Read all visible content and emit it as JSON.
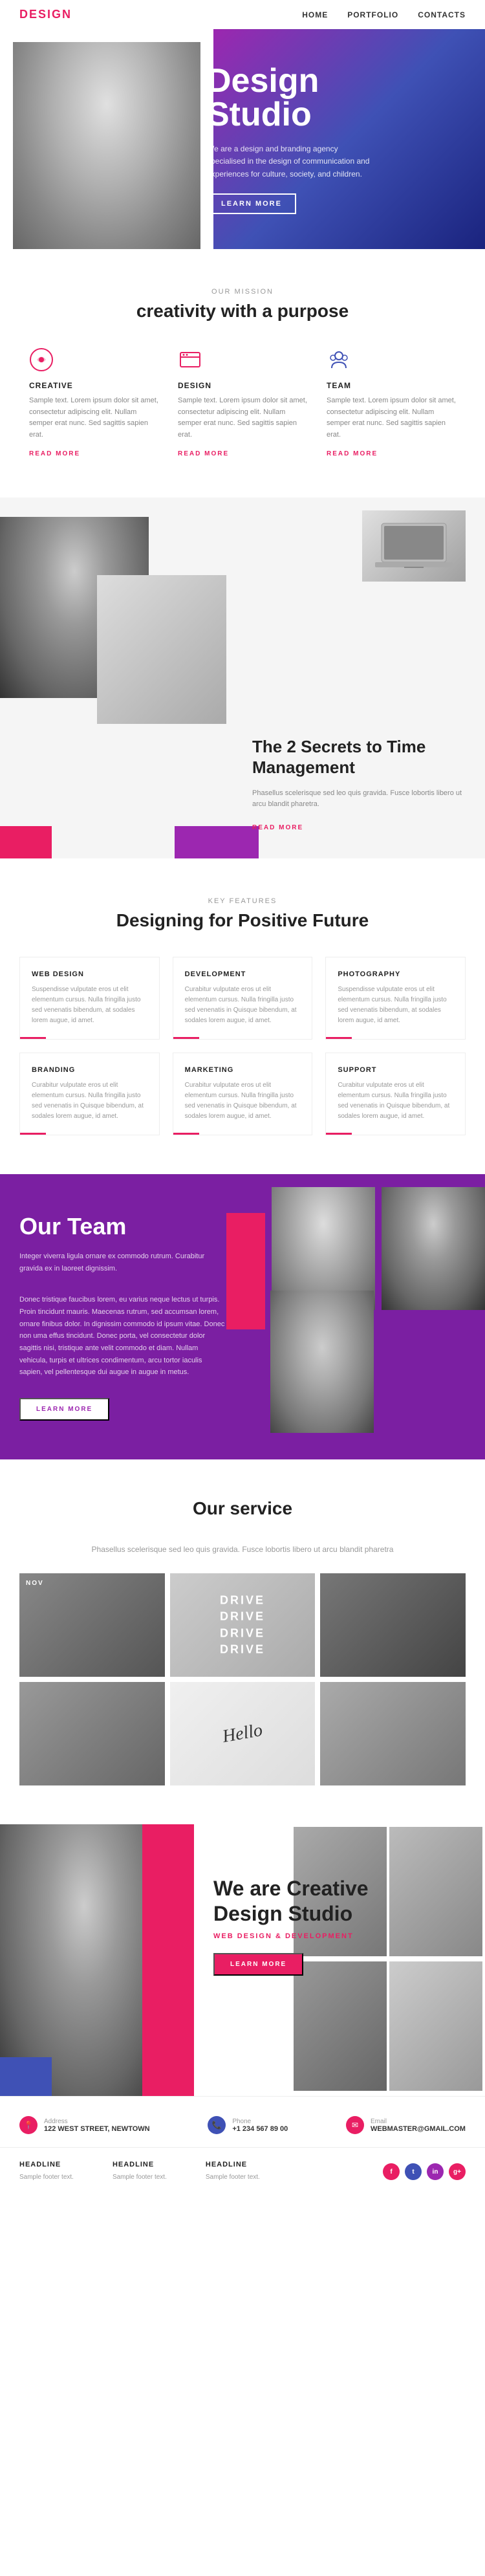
{
  "nav": {
    "logo": "DESIGN",
    "links": [
      "HOME",
      "PORTFOLIO",
      "CONTACTS"
    ]
  },
  "hero": {
    "title": "Design\nStudio",
    "description": "We are a design and branding agency specialised in the design of communication and experiences for culture, society, and children.",
    "cta_label": "LEARN MORE"
  },
  "mission": {
    "section_label": "OUR MISSION",
    "section_title": "creativity with a purpose",
    "items": [
      {
        "icon": "♡",
        "title": "CREATIVE",
        "text": "Sample text. Lorem ipsum dolor sit amet, consectetur adipiscing elit. Nullam semper erat nunc. Sed sagittis sapien erat.",
        "read_more": "READ MORE"
      },
      {
        "icon": "✦",
        "title": "DESIGN",
        "text": "Sample text. Lorem ipsum dolor sit amet, consectetur adipiscing elit. Nullam semper erat nunc. Sed sagittis sapien erat.",
        "read_more": "READ MORE"
      },
      {
        "icon": "👤",
        "title": "TEAM",
        "text": "Sample text. Lorem ipsum dolor sit amet, consectetur adipiscing elit. Nullam semper erat nunc. Sed sagittis sapien erat.",
        "read_more": "READ MORE"
      }
    ]
  },
  "secrets": {
    "title": "The 2 Secrets to Time Management",
    "text": "Phasellus scelerisque sed leo quis gravida. Fusce lobortis libero ut arcu blandit pharetra.",
    "read_more": "READ MORE"
  },
  "features": {
    "section_label": "KEY FEATURES",
    "section_title": "Designing for Positive Future",
    "cards": [
      {
        "title": "WEB DESIGN",
        "text": "Suspendisse vulputate eros ut elit elementum cursus. Nulla fringilla justo sed venenatis bibendum, at sodales lorem augue, id amet."
      },
      {
        "title": "DEVELOPMENT",
        "text": "Curabitur vulputate eros ut elit elementum cursus. Nulla fringilla justo sed venenatis in Quisque bibendum, at sodales lorem augue, id amet."
      },
      {
        "title": "PHOTOGRAPHY",
        "text": "Suspendisse vulputate eros ut elit elementum cursus. Nulla fringilla justo sed venenatis bibendum, at sodales lorem augue, id amet."
      },
      {
        "title": "BRANDING",
        "text": "Curabitur vulputate eros ut elit elementum cursus. Nulla fringilla justo sed venenatis in Quisque bibendum, at sodales lorem augue, id amet."
      },
      {
        "title": "MARKETING",
        "text": "Curabitur vulputate eros ut elit elementum cursus. Nulla fringilla justo sed venenatis in Quisque bibendum, at sodales lorem augue, id amet."
      },
      {
        "title": "SUPPORT",
        "text": "Curabitur vulputate eros ut elit elementum cursus. Nulla fringilla justo sed venenatis in Quisque bibendum, at sodales lorem augue, id amet."
      }
    ]
  },
  "team": {
    "title": "Our Team",
    "intro": "Integer viverra ligula ornare ex commodo rutrum. Curabitur gravida ex in laoreet dignissim.",
    "text": "Donec tristique faucibus lorem, eu varius neque lectus ut turpis. Proin tincidunt mauris. Maecenas rutrum, sed accumsan lorem, ornare finibus dolor. In dignissim commodo id ipsum vitae. Donec non uma effus tincidunt. Donec porta, vel consectetur dolor sagittis nisi, tristique ante velit commodo et diam. Nullam vehicula, turpis et ultrices condimentum, arcu tortor iaculis sapien, vel pellentesque dui augue in augue in metus.",
    "cta_label": "LEARN MORE"
  },
  "service": {
    "section_title": "Our service",
    "section_desc": "Phasellus scelerisque sed leo quis gravida. Fusce lobortis libero ut arcu blandit pharetra",
    "drive_text": "DRIVE\nDRIVE\nDRIVE\nDRIVE",
    "hello_text": "Hello"
  },
  "cta": {
    "title": "We are Creative\nDesign Studio",
    "subtitle": "WEB DESIGN & DEVELOPMENT",
    "cta_label": "LEARN MORE"
  },
  "footer": {
    "contacts": [
      {
        "icon": "📍",
        "label": "122 WEST STREET, NEWTOWN",
        "value": "122 WEST STREET, NEWTOWN"
      },
      {
        "icon": "📞",
        "label": "+1 234 567 89 00",
        "value": "+1 234 567 89 00"
      },
      {
        "icon": "✉",
        "label": "WEBMASTER@GMAIL.COM",
        "value": "WEBMASTER@GMAIL.COM"
      }
    ],
    "cols": [
      {
        "title": "HEADLINE",
        "text": "Sample footer text."
      },
      {
        "title": "HEADLINE",
        "text": "Sample footer text."
      },
      {
        "title": "HEADLINE",
        "text": "Sample footer text."
      }
    ],
    "social": [
      "f",
      "t",
      "in",
      "g+"
    ]
  }
}
